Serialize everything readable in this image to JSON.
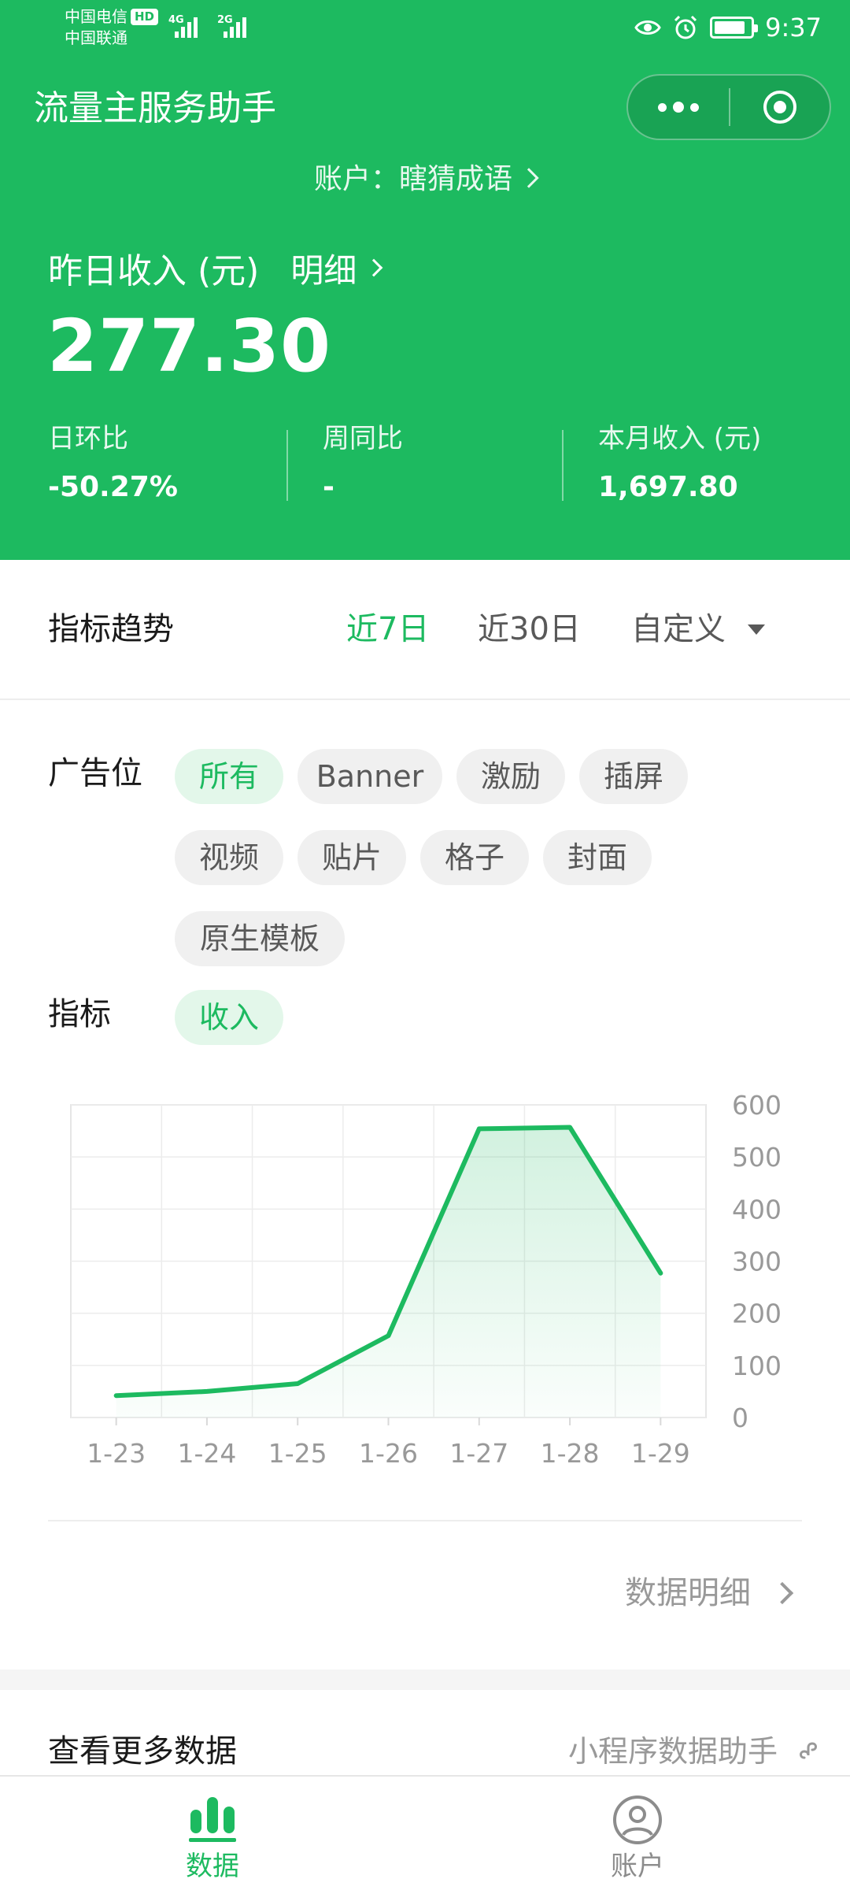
{
  "status_bar": {
    "carrier_1": "中国电信",
    "carrier_1_badge": "HD",
    "carrier_2": "中国联通",
    "net_1": "4G",
    "net_2": "2G",
    "time": "9:37",
    "battery_level": 0.85
  },
  "nav": {
    "title": "流量主服务助手"
  },
  "account": {
    "label": "账户：瞎猜成语"
  },
  "income": {
    "label": "昨日收入 (元)",
    "detail_link": "明细",
    "value": "277.30"
  },
  "stats": [
    {
      "label": "日环比",
      "value": "-50.27%"
    },
    {
      "label": "周同比",
      "value": "-"
    },
    {
      "label": "本月收入 (元)",
      "value": "1,697.80"
    }
  ],
  "trend": {
    "title": "指标趋势",
    "options": [
      "近7日",
      "近30日",
      "自定义"
    ],
    "active_option": "近7日"
  },
  "filters": {
    "ad_slot_label": "广告位",
    "ad_slots": [
      "所有",
      "Banner",
      "激励",
      "插屏",
      "视频",
      "贴片",
      "格子",
      "封面",
      "原生模板"
    ],
    "active_ad_slot": "所有",
    "metric_label": "指标",
    "metrics": [
      "收入"
    ],
    "active_metric": "收入"
  },
  "chart_data": {
    "type": "area",
    "x": [
      "1-23",
      "1-24",
      "1-25",
      "1-26",
      "1-27",
      "1-28",
      "1-29"
    ],
    "values": [
      42,
      50,
      65,
      157,
      554,
      557,
      277
    ],
    "ylim": [
      0,
      600
    ],
    "yticks": [
      0,
      100,
      200,
      300,
      400,
      500,
      600
    ],
    "y_axis_position": "right",
    "grid": true,
    "colors": {
      "line": "#1dba60",
      "fill": "#1dba60"
    }
  },
  "data_detail": {
    "label": "数据明细"
  },
  "more": {
    "title": "查看更多数据",
    "link": "小程序数据助手"
  },
  "tabbar": {
    "items": [
      {
        "label": "数据",
        "icon": "bar-chart-icon",
        "active": true
      },
      {
        "label": "账户",
        "icon": "user-circle-icon",
        "active": false
      }
    ]
  },
  "colors": {
    "brand": "#1dba60",
    "active_chip_bg": "#e3f7ea",
    "chip_bg": "#f0f0f0",
    "muted_text": "#999999"
  }
}
